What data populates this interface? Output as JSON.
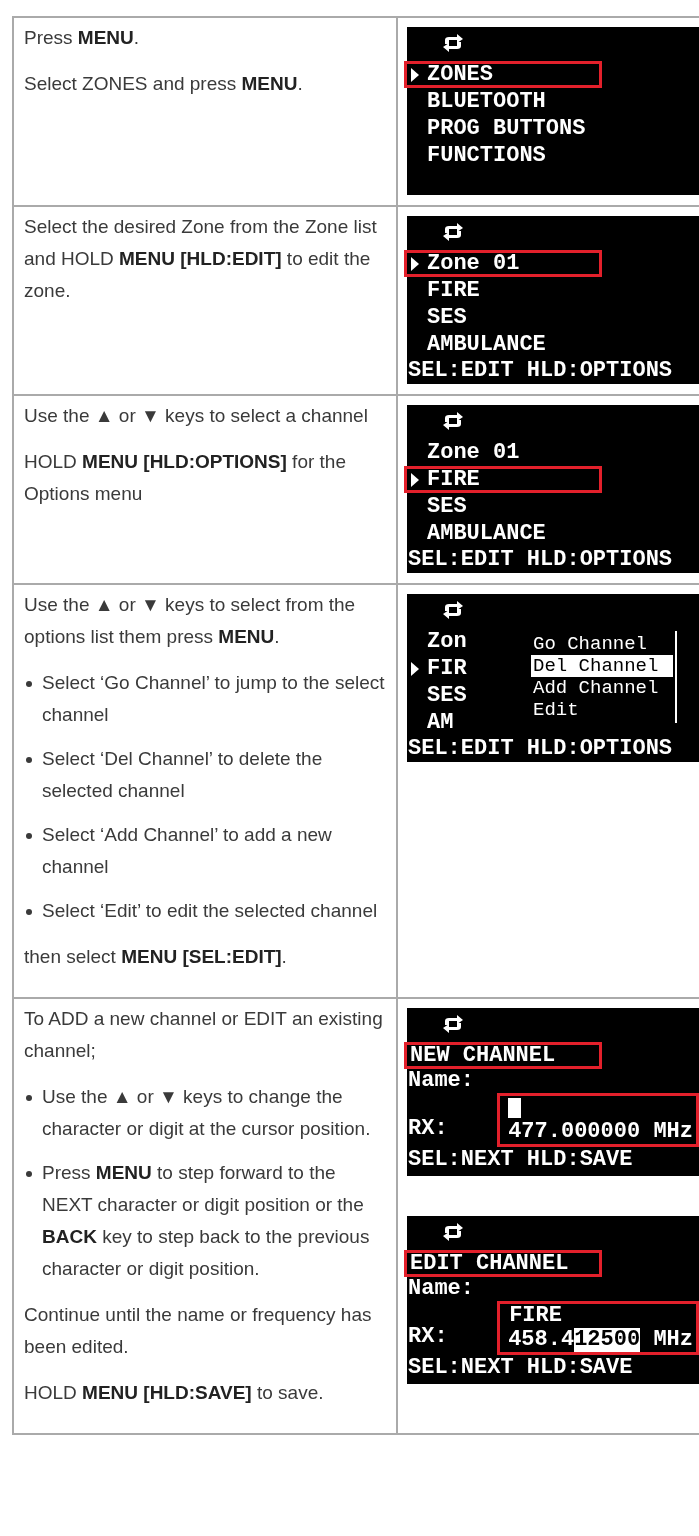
{
  "rows": [
    {
      "steps": [
        {
          "kind": "para",
          "text": "Press **MENU**."
        },
        {
          "kind": "para",
          "text": "Select ZONES and press **MENU**."
        }
      ],
      "screens": [
        {
          "kind": "menu",
          "items": [
            {
              "text": "ZONES",
              "selected": true,
              "boxed": true
            },
            {
              "text": "BLUETOOTH",
              "selected": false,
              "boxed": false
            },
            {
              "text": "PROG BUTTONS",
              "selected": false,
              "boxed": false
            },
            {
              "text": "FUNCTIONS",
              "selected": false,
              "boxed": false
            }
          ]
        }
      ]
    },
    {
      "steps": [
        {
          "kind": "para",
          "text": "Select the desired Zone from the Zone list and HOLD **MENU [HLD:EDIT]** to edit the zone."
        }
      ],
      "screens": [
        {
          "kind": "menu",
          "items": [
            {
              "text": "Zone 01",
              "selected": true,
              "boxed": true
            },
            {
              "text": "FIRE",
              "selected": false,
              "boxed": false
            },
            {
              "text": "SES",
              "selected": false,
              "boxed": false
            },
            {
              "text": "AMBULANCE",
              "selected": false,
              "boxed": false
            }
          ],
          "footer": "SEL:EDIT HLD:OPTIONS"
        }
      ]
    },
    {
      "steps": [
        {
          "kind": "para",
          "text": "Use the ▲ or ▼ keys to select a channel"
        },
        {
          "kind": "para",
          "text": "HOLD **MENU [HLD:OPTIONS]** for the Options menu"
        }
      ],
      "screens": [
        {
          "kind": "menu",
          "items": [
            {
              "text": "Zone 01",
              "selected": false,
              "boxed": false
            },
            {
              "text": "FIRE",
              "selected": true,
              "boxed": true
            },
            {
              "text": "SES",
              "selected": false,
              "boxed": false
            },
            {
              "text": "AMBULANCE",
              "selected": false,
              "boxed": false
            }
          ],
          "footer": "SEL:EDIT HLD:OPTIONS"
        }
      ]
    },
    {
      "steps": [
        {
          "kind": "para",
          "text": "Use the ▲ or ▼ keys to select from the options list them press **MENU**."
        },
        {
          "kind": "bullets",
          "items": [
            "Select ‘Go Channel’ to jump to the select channel",
            "Select ‘Del Channel’ to delete the selected channel",
            "Select ‘Add Channel’ to add a new channel",
            "Select ‘Edit’ to edit the selected channel"
          ]
        },
        {
          "kind": "para",
          "text": "then select **MENU [SEL:EDIT]**."
        }
      ],
      "screens": [
        {
          "kind": "menu",
          "items": [
            {
              "text": "Zon",
              "selected": false,
              "boxed": false
            },
            {
              "text": "FIR",
              "selected": true,
              "boxed": false
            },
            {
              "text": "SES",
              "selected": false,
              "boxed": false
            },
            {
              "text": "AM",
              "selected": false,
              "boxed": false
            }
          ],
          "footer": "SEL:EDIT HLD:OPTIONS",
          "popup": [
            {
              "text": "Go Channel",
              "selected": false
            },
            {
              "text": "Del Channel",
              "selected": true
            },
            {
              "text": "Add Channel",
              "selected": false
            },
            {
              "text": "Edit",
              "selected": false
            }
          ]
        }
      ]
    },
    {
      "steps": [
        {
          "kind": "para",
          "text": "To ADD a new channel or EDIT an existing channel;"
        },
        {
          "kind": "bullets",
          "items": [
            "Use the ▲ or ▼ keys to change the character or digit at the cursor position.",
            "Press **MENU** to step forward to the NEXT character or digit position or the **BACK** key to step back to the previous character or digit position."
          ]
        },
        {
          "kind": "para",
          "text": "Continue until the name or frequency has been edited."
        },
        {
          "kind": "para",
          "text": "HOLD **MENU [HLD:SAVE]** to save."
        }
      ],
      "screens": [
        {
          "kind": "editor",
          "title": "NEW CHANNEL",
          "name_label": "Name:",
          "cursor": true,
          "rx_label": "RX:",
          "rx_value": [
            {
              "text": "477.000000 MHz",
              "inverted": false
            }
          ],
          "footer": "SEL:NEXT HLD:SAVE"
        },
        {
          "kind": "editor",
          "title": "EDIT CHANNEL",
          "name_label": "Name:",
          "name_value": "FIRE",
          "cursor": false,
          "rx_label": "RX:",
          "rx_value": [
            {
              "text": "458.4",
              "inverted": false
            },
            {
              "text": "12500",
              "inverted": true
            },
            {
              "text": " MHz",
              "inverted": false
            }
          ],
          "footer": "SEL:NEXT HLD:SAVE"
        }
      ]
    }
  ]
}
